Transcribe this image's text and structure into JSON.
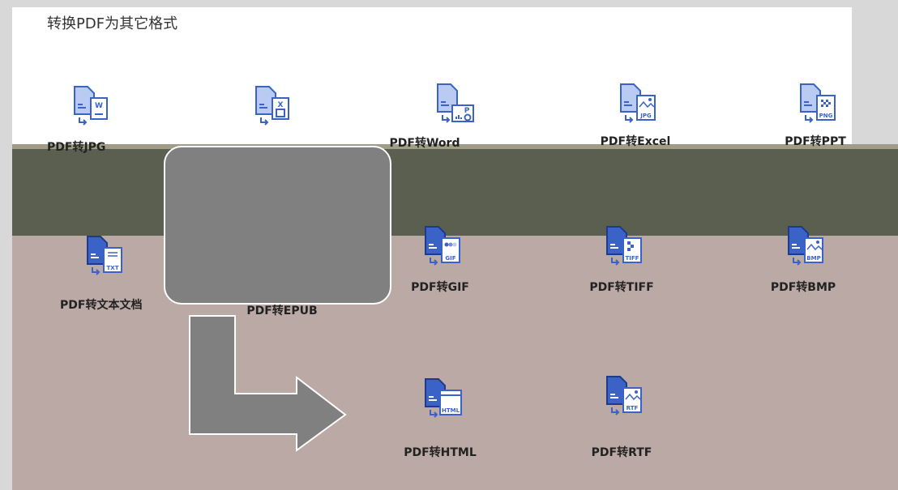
{
  "header": {
    "title": "转换PDF为其它格式"
  },
  "items": [
    {
      "label": "PDF转JPG",
      "badge": "W"
    },
    {
      "label": "",
      "badge": "X"
    },
    {
      "label": "PDF转Word",
      "badge": "P"
    },
    {
      "label": "PDF转Excel",
      "badge": "JPG"
    },
    {
      "label": "PDF转PPT",
      "badge": "PNG"
    },
    {
      "label": "PDF转文本文档",
      "badge": "TXT"
    },
    {
      "label": "PDF转EPUB",
      "badge": ""
    },
    {
      "label": "PDF转GIF",
      "badge": "GIF"
    },
    {
      "label": "PDF转TIFF",
      "badge": "TIFF"
    },
    {
      "label": "PDF转BMP",
      "badge": "BMP"
    },
    {
      "label": "PDF转HTML",
      "badge": "HTML"
    },
    {
      "label": "PDF转RTF",
      "badge": "RTF"
    }
  ],
  "colors": {
    "icon": "#3b63c7",
    "iconLight": "#b9cbf2",
    "bandDark": "#5a5f50",
    "bandTan": "#baa9a4"
  }
}
